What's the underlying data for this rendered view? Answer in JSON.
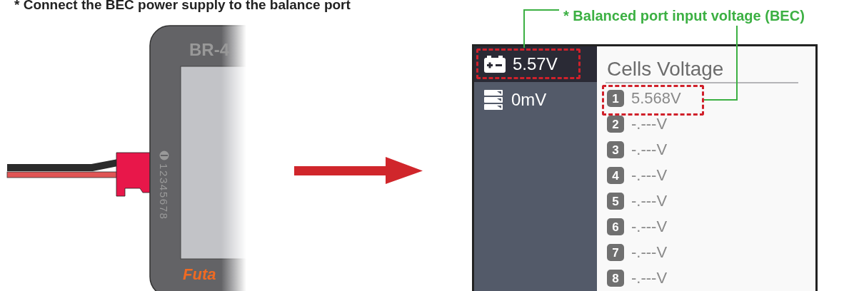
{
  "caption": "* Connect the BEC power supply to the balance port",
  "device": {
    "model": "BR-4",
    "pins": "12345678",
    "brand": "Futa"
  },
  "callout": {
    "label": "* Balanced port input voltage (BEC)"
  },
  "screen": {
    "sidebar": {
      "items": [
        {
          "kind": "battery",
          "label": "5.57V",
          "selected": true
        },
        {
          "kind": "cells",
          "label": "0mV",
          "selected": false
        }
      ]
    },
    "title": "Cells Voltage",
    "cells": [
      {
        "index": "1",
        "value": "5.568V"
      },
      {
        "index": "2",
        "value": "-.---V"
      },
      {
        "index": "3",
        "value": "-.---V"
      },
      {
        "index": "4",
        "value": "-.---V"
      },
      {
        "index": "5",
        "value": "-.---V"
      },
      {
        "index": "6",
        "value": "-.---V"
      },
      {
        "index": "7",
        "value": "-.---V"
      },
      {
        "index": "8",
        "value": "-.---V"
      }
    ]
  }
}
